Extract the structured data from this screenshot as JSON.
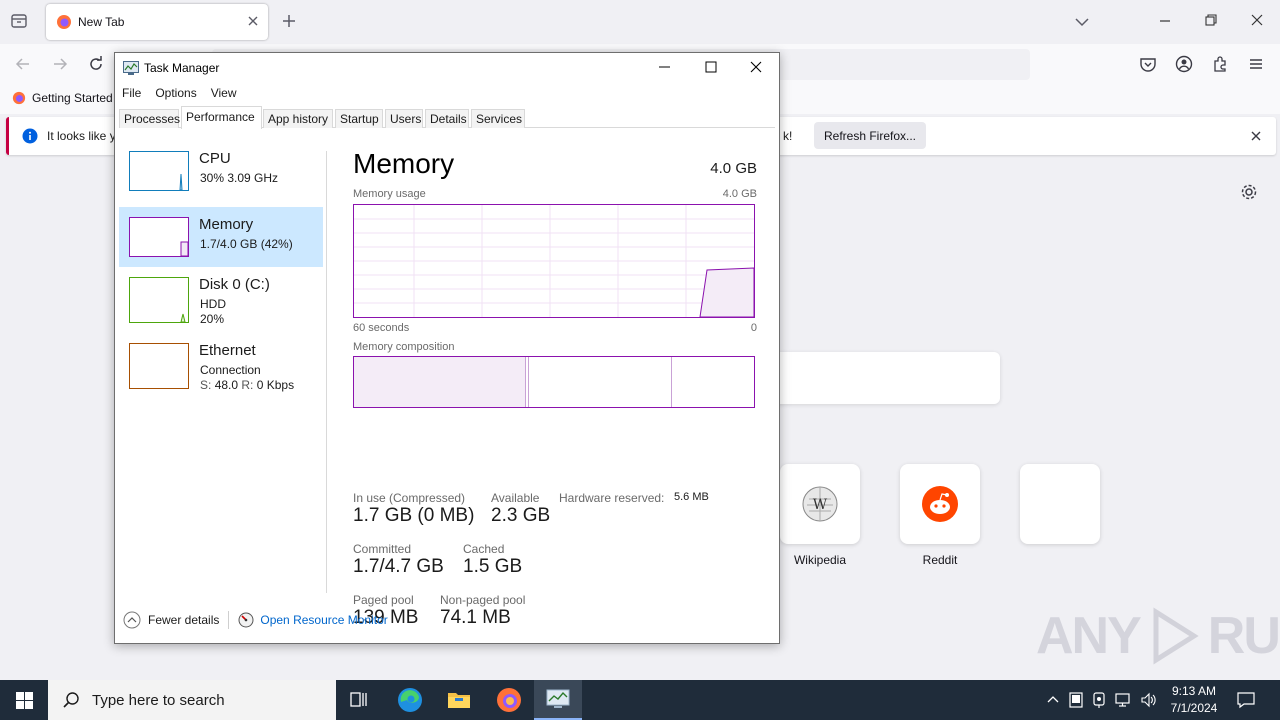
{
  "firefox": {
    "tab_title": "New Tab",
    "bookmark_label": "Getting Started",
    "notice_text_left": "It looks like y",
    "notice_text_right": "k!",
    "refresh_button": "Refresh Firefox...",
    "top_sites": [
      {
        "label": "Wikipedia"
      },
      {
        "label": "Reddit"
      },
      {
        "label": ""
      }
    ]
  },
  "task_manager": {
    "title": "Task Manager",
    "menu": [
      "File",
      "Options",
      "View"
    ],
    "tabs": [
      "Processes",
      "Performance",
      "App history",
      "Startup",
      "Users",
      "Details",
      "Services"
    ],
    "active_tab": "Performance",
    "sidebar": [
      {
        "name": "CPU",
        "line1": "30%  3.09 GHz",
        "line2": "",
        "color": "#117dbb",
        "active": false
      },
      {
        "name": "Memory",
        "line1": "1.7/4.0 GB (42%)",
        "line2": "",
        "color": "#8b12ae",
        "active": true
      },
      {
        "name": "Disk 0 (C:)",
        "line1": "HDD",
        "line2": "20%",
        "color": "#4da60c",
        "active": false
      },
      {
        "name": "Ethernet",
        "line1": "Connection",
        "line2_s_label": "S:",
        "line2_s": "48.0",
        "line2_r_label": "R:",
        "line2_r": "0 Kbps",
        "color": "#a74f01",
        "active": false
      }
    ],
    "memory": {
      "title": "Memory",
      "total": "4.0 GB",
      "usage_label": "Memory usage",
      "usage_max": "4.0 GB",
      "time_left": "60 seconds",
      "time_right": "0",
      "composition_label": "Memory composition",
      "in_use_label": "In use (Compressed)",
      "in_use_value": "1.7 GB (0 MB)",
      "available_label": "Available",
      "available_value": "2.3 GB",
      "hw_reserved_label": "Hardware reserved:",
      "hw_reserved_value": "5.6 MB",
      "committed_label": "Committed",
      "committed_value": "1.7/4.7 GB",
      "cached_label": "Cached",
      "cached_value": "1.5 GB",
      "paged_label": "Paged pool",
      "paged_value": "139 MB",
      "nonpaged_label": "Non-paged pool",
      "nonpaged_value": "74.1 MB"
    },
    "footer": {
      "fewer_details": "Fewer details",
      "open_resource_monitor": "Open Resource Monitor"
    }
  },
  "taskbar": {
    "search_placeholder": "Type here to search",
    "time": "9:13 AM",
    "date": "7/1/2024"
  },
  "watermark": {
    "left": "ANY",
    "right": "RUN"
  },
  "colors": {
    "memory_accent": "#8b12ae",
    "cpu_accent": "#117dbb",
    "disk_accent": "#4da60c",
    "ethernet_accent": "#a74f01",
    "taskbar_bg": "#1f2c3a",
    "link": "#0066cc"
  }
}
